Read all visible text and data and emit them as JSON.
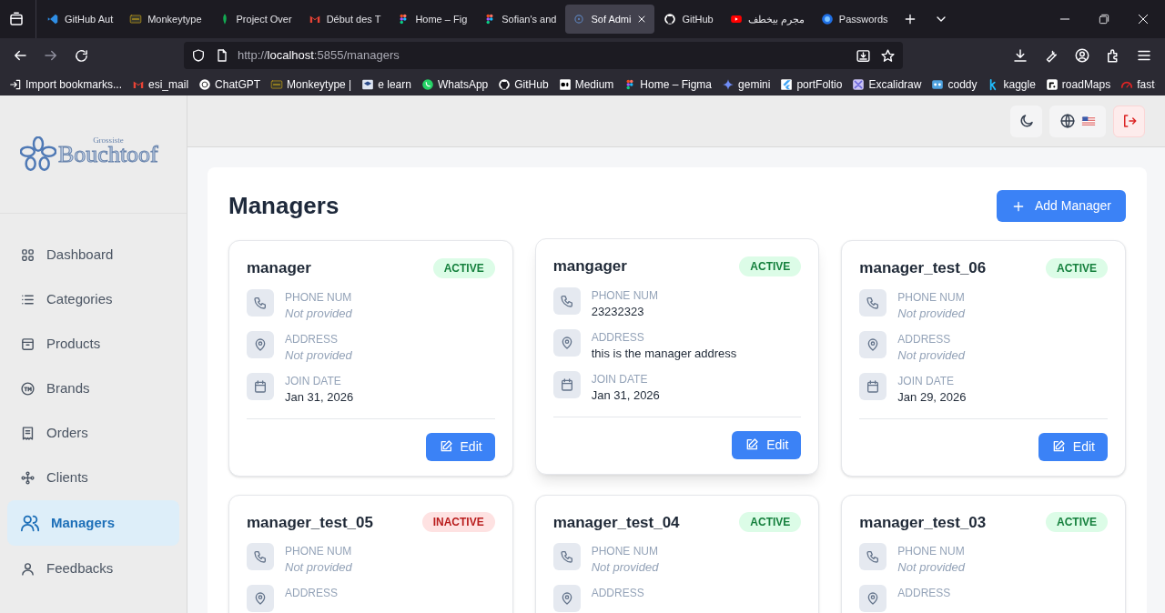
{
  "browser": {
    "tabs": [
      {
        "label": "GitHub Aut",
        "selected": false
      },
      {
        "label": "Monkeytype",
        "selected": false
      },
      {
        "label": "Project Over",
        "selected": false
      },
      {
        "label": "Début des T",
        "selected": false
      },
      {
        "label": "Home – Fig",
        "selected": false
      },
      {
        "label": "Sofian's and",
        "selected": false
      },
      {
        "label": "Sof Admi",
        "selected": true
      },
      {
        "label": "GitHub",
        "selected": false
      },
      {
        "label": "مجرم بيخطف",
        "selected": false
      },
      {
        "label": "Passwords",
        "selected": false
      }
    ],
    "url_scheme": "http://",
    "url_host": "localhost",
    "url_path": ":5855/managers",
    "bookmarks": [
      "Import bookmarks...",
      "esi_mail",
      "ChatGPT",
      "Monkeytype |",
      "e learn",
      "WhatsApp",
      "GitHub",
      "Medium",
      "Home – Figma",
      "gemini",
      "portFoltio",
      "Excalidraw",
      "coddy",
      "kaggle",
      "roadMaps",
      "fast"
    ]
  },
  "logo": {
    "small": "Grossiste",
    "large": "Bouchtoof"
  },
  "sidebar": {
    "items": [
      {
        "label": "Dashboard",
        "selected": false
      },
      {
        "label": "Categories",
        "selected": false
      },
      {
        "label": "Products",
        "selected": false
      },
      {
        "label": "Brands",
        "selected": false
      },
      {
        "label": "Orders",
        "selected": false
      },
      {
        "label": "Clients",
        "selected": false
      },
      {
        "label": "Managers",
        "selected": true
      },
      {
        "label": "Feedbacks",
        "selected": false
      }
    ]
  },
  "page": {
    "title": "Managers",
    "add_button": "Add Manager"
  },
  "managers": [
    {
      "name": "manager",
      "status": "ACTIVE",
      "active": true,
      "hovered": false,
      "edit": "Edit",
      "fields": [
        {
          "kind": "phone",
          "label": "PHONE NUM",
          "value": "Not provided",
          "empty": true
        },
        {
          "kind": "address",
          "label": "ADDRESS",
          "value": "Not provided",
          "empty": true
        },
        {
          "kind": "date",
          "label": "JOIN DATE",
          "value": "Jan 31, 2026",
          "empty": false
        }
      ]
    },
    {
      "name": "mangager",
      "status": "ACTIVE",
      "active": true,
      "hovered": true,
      "edit": "Edit",
      "fields": [
        {
          "kind": "phone",
          "label": "PHONE NUM",
          "value": "23232323",
          "empty": false
        },
        {
          "kind": "address",
          "label": "ADDRESS",
          "value": "this is the manager address",
          "empty": false
        },
        {
          "kind": "date",
          "label": "JOIN DATE",
          "value": "Jan 31, 2026",
          "empty": false
        }
      ]
    },
    {
      "name": "manager_test_06",
      "status": "ACTIVE",
      "active": true,
      "hovered": false,
      "edit": "Edit",
      "fields": [
        {
          "kind": "phone",
          "label": "PHONE NUM",
          "value": "Not provided",
          "empty": true
        },
        {
          "kind": "address",
          "label": "ADDRESS",
          "value": "Not provided",
          "empty": true
        },
        {
          "kind": "date",
          "label": "JOIN DATE",
          "value": "Jan 29, 2026",
          "empty": false
        }
      ]
    },
    {
      "name": "manager_test_05",
      "status": "INACTIVE",
      "active": false,
      "hovered": false,
      "fields": [
        {
          "kind": "phone",
          "label": "PHONE NUM",
          "value": "Not provided",
          "empty": true
        },
        {
          "kind": "address",
          "label": "ADDRESS"
        }
      ]
    },
    {
      "name": "manager_test_04",
      "status": "ACTIVE",
      "active": true,
      "hovered": false,
      "fields": [
        {
          "kind": "phone",
          "label": "PHONE NUM",
          "value": "Not provided",
          "empty": true
        },
        {
          "kind": "address",
          "label": "ADDRESS"
        }
      ]
    },
    {
      "name": "manager_test_03",
      "status": "ACTIVE",
      "active": true,
      "hovered": false,
      "fields": [
        {
          "kind": "phone",
          "label": "PHONE NUM",
          "value": "Not provided",
          "empty": true
        },
        {
          "kind": "address",
          "label": "ADDRESS"
        }
      ]
    }
  ]
}
